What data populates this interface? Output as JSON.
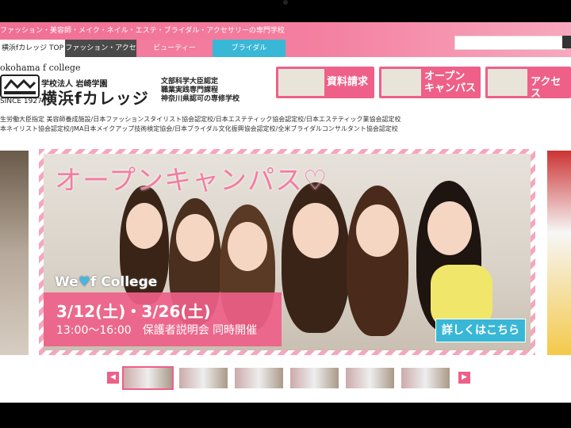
{
  "header": {
    "tagline": "ファッション・美容師・メイク・ネイル・エステ・ブライダル・アクセサリーの専門学校",
    "search_placeholder": "",
    "nav": [
      {
        "label": "横浜fカレッジ TOP"
      },
      {
        "label": "ファッション・アクセサリー"
      },
      {
        "label": "ビューティー"
      },
      {
        "label": "ブライダル"
      }
    ]
  },
  "logo": {
    "english": "okohama f college",
    "since": "SINCE 1927",
    "corporation": "学校法人 岩崎学園",
    "school_name": "横浜fカレッジ",
    "cert_lines": [
      "文部科学大臣認定",
      "職業実践専門課程",
      "神奈川県認可の専修学校"
    ]
  },
  "header_buttons": [
    {
      "label": "資料請求"
    },
    {
      "label": "オープン キャンパス"
    },
    {
      "label": "アクセス"
    }
  ],
  "accreditations": [
    "生労働大臣指定 美容師養成施設/日本ファッションスタイリスト協会認定校/日本エステティック協会認定校/日本エステティック業協会認定校",
    "本ネイリスト協会認定校/JMA日本メイクアップ技術検定協会/日本ブライダル文化振興協会認定校/全米ブライダルコンサルタント協会認定校"
  ],
  "hero": {
    "title": "オープンキャンパス♡",
    "we_prefix": "We",
    "we_suffix": "f College",
    "dates": "3/12(土)・3/26(土)",
    "time": "13:00〜16:00　保護者説明会 同時開催",
    "detail_button": "詳しくはこちら"
  },
  "carousel": {
    "prev": "◀",
    "next": "▶",
    "thumbnail_count": 7
  },
  "colors": {
    "pink": "#ee6088",
    "cyan": "#39b7d6",
    "dark": "#4a4a4a"
  }
}
